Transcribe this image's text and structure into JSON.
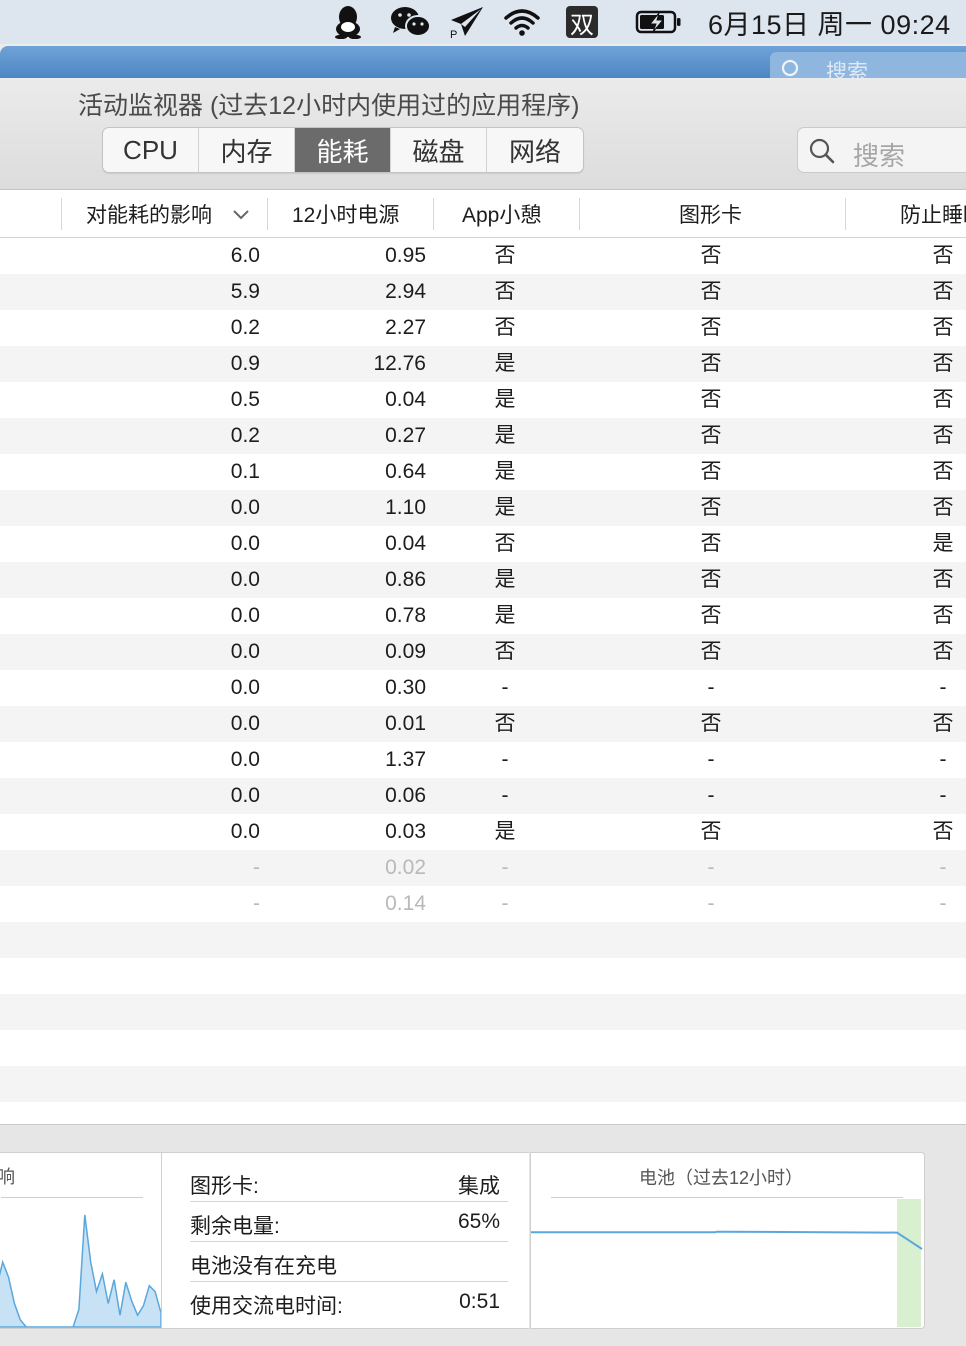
{
  "menubar": {
    "icons": [
      "qq-icon",
      "wechat-icon",
      "paper-plane-icon",
      "wifi-icon",
      "input-method-icon",
      "battery-icon"
    ],
    "input_method_label": "双",
    "plane_badge": "P",
    "clock": "6月15日 周一 09:24"
  },
  "titlebar": {
    "search_placeholder": "搜索"
  },
  "window": {
    "title": "活动监视器 (过去12小时内使用过的应用程序)",
    "tabs": [
      {
        "label": "CPU",
        "active": false
      },
      {
        "label": "内存",
        "active": false
      },
      {
        "label": "能耗",
        "active": true
      },
      {
        "label": "磁盘",
        "active": false
      },
      {
        "label": "网络",
        "active": false
      }
    ],
    "search_placeholder": "搜索"
  },
  "table": {
    "columns": {
      "impact": "对能耗的影响",
      "power12h": "12小时电源",
      "app_nap": "App小憩",
      "graphics": "图形卡",
      "prevent_sleep": "防止睡眠"
    },
    "rows": [
      {
        "impact": "6.0",
        "power": "0.95",
        "nap": "否",
        "gfx": "否",
        "sleep": "否",
        "dim": false
      },
      {
        "impact": "5.9",
        "power": "2.94",
        "nap": "否",
        "gfx": "否",
        "sleep": "否",
        "dim": false
      },
      {
        "impact": "0.2",
        "power": "2.27",
        "nap": "否",
        "gfx": "否",
        "sleep": "否",
        "dim": false
      },
      {
        "impact": "0.9",
        "power": "12.76",
        "nap": "是",
        "gfx": "否",
        "sleep": "否",
        "dim": false
      },
      {
        "impact": "0.5",
        "power": "0.04",
        "nap": "是",
        "gfx": "否",
        "sleep": "否",
        "dim": false
      },
      {
        "impact": "0.2",
        "power": "0.27",
        "nap": "是",
        "gfx": "否",
        "sleep": "否",
        "dim": false
      },
      {
        "impact": "0.1",
        "power": "0.64",
        "nap": "是",
        "gfx": "否",
        "sleep": "否",
        "dim": false
      },
      {
        "impact": "0.0",
        "power": "1.10",
        "nap": "是",
        "gfx": "否",
        "sleep": "否",
        "dim": false
      },
      {
        "impact": "0.0",
        "power": "0.04",
        "nap": "否",
        "gfx": "否",
        "sleep": "是",
        "dim": false
      },
      {
        "impact": "0.0",
        "power": "0.86",
        "nap": "是",
        "gfx": "否",
        "sleep": "否",
        "dim": false
      },
      {
        "impact": "0.0",
        "power": "0.78",
        "nap": "是",
        "gfx": "否",
        "sleep": "否",
        "dim": false
      },
      {
        "impact": "0.0",
        "power": "0.09",
        "nap": "否",
        "gfx": "否",
        "sleep": "否",
        "dim": false
      },
      {
        "impact": "0.0",
        "power": "0.30",
        "nap": "-",
        "gfx": "-",
        "sleep": "-",
        "dim": false
      },
      {
        "impact": "0.0",
        "power": "0.01",
        "nap": "否",
        "gfx": "否",
        "sleep": "否",
        "dim": false
      },
      {
        "impact": "0.0",
        "power": "1.37",
        "nap": "-",
        "gfx": "-",
        "sleep": "-",
        "dim": false
      },
      {
        "impact": "0.0",
        "power": "0.06",
        "nap": "-",
        "gfx": "-",
        "sleep": "-",
        "dim": false
      },
      {
        "impact": "0.0",
        "power": "0.03",
        "nap": "是",
        "gfx": "否",
        "sleep": "否",
        "dim": false
      },
      {
        "impact": "-",
        "power": "0.02",
        "nap": "-",
        "gfx": "-",
        "sleep": "-",
        "dim": true
      },
      {
        "impact": "-",
        "power": "0.14",
        "nap": "-",
        "gfx": "-",
        "sleep": "-",
        "dim": true
      }
    ]
  },
  "bottom": {
    "impact_chart_title": "响",
    "impact_chart_values": [
      0.02,
      0.35,
      0.55,
      0.42,
      0.2,
      0.06,
      0.0,
      0.0,
      0.0,
      0.0,
      0.0,
      0.0,
      0.0,
      0.0,
      0.0,
      0.15,
      0.95,
      0.55,
      0.3,
      0.45,
      0.2,
      0.4,
      0.1,
      0.38,
      0.22,
      0.1,
      0.18,
      0.35,
      0.3,
      0.12
    ],
    "graphics_label": "图形卡:",
    "graphics_value": "集成",
    "remaining_label": "剩余电量:",
    "remaining_value": "65%",
    "charging_status": "电池没有在充电",
    "ac_time_label": "使用交流电时间:",
    "ac_time_value": "0:51",
    "battery_chart_title": "电池（过去12小时）",
    "battery_level_start_pct": 79,
    "battery_level_end_pct": 65,
    "chart_color": "#5aa7de",
    "charging_band_color": "#d8f0cf"
  }
}
